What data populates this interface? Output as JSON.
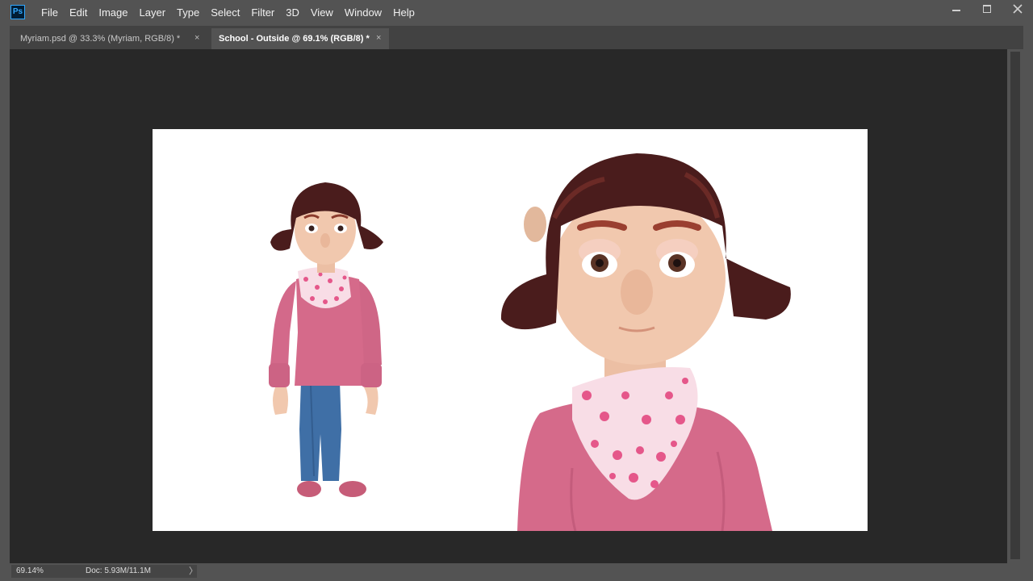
{
  "app": {
    "logo_text": "Ps"
  },
  "menu": {
    "items": [
      "File",
      "Edit",
      "Image",
      "Layer",
      "Type",
      "Select",
      "Filter",
      "3D",
      "View",
      "Window",
      "Help"
    ]
  },
  "tabs": [
    {
      "label": "Myriam.psd @ 33.3% (Myriam, RGB/8) *",
      "active": false
    },
    {
      "label": "School - Outside @ 69.1% (RGB/8) *",
      "active": true
    }
  ],
  "tab_close_glyph": "×",
  "status": {
    "zoom": "69.14%",
    "doc_info": "Doc: 5.93M/11.1M",
    "arrow": "〉"
  },
  "colors": {
    "accent": "#31a8ff",
    "sweater": "#d56a8a",
    "jeans": "#3f6fa6",
    "hair": "#4a1c1c",
    "skin": "#f1c8ae",
    "canvas_background": "#ffffff"
  },
  "icons": {
    "minimize": "minimize-icon",
    "maximize": "maximize-icon",
    "close": "close-icon",
    "tab_close": "close-icon"
  }
}
